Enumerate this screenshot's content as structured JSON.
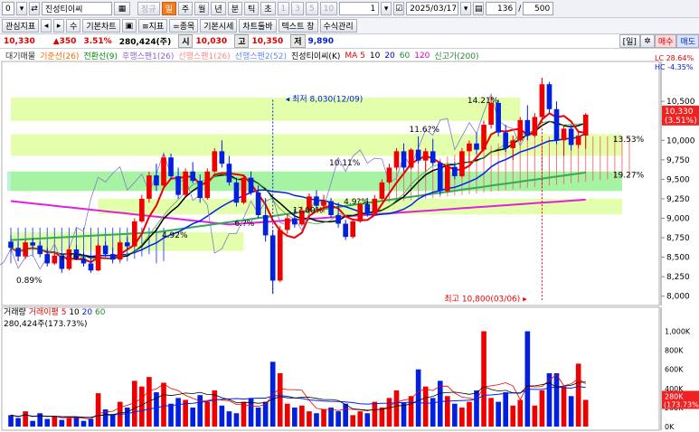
{
  "toolbar": {
    "code": "0",
    "stock_name": "진성티이씨",
    "periods": [
      "정규",
      "일",
      "주",
      "월",
      "년",
      "분",
      "틱",
      "초"
    ],
    "selected_period": "일",
    "minutes": [
      "1",
      "3",
      "5",
      "10"
    ],
    "count_value": "1",
    "date": "2025/03/17",
    "count": "136",
    "total": "500"
  },
  "toolbar2": {
    "items": [
      "관심지표",
      "◂",
      "▸",
      "수",
      "기본차트",
      "▣",
      "≡지표",
      "=종목",
      "기본시세",
      "차트툴바",
      "텍스트 창",
      "수식관리"
    ]
  },
  "quote": {
    "price": "10,330",
    "change": "▲350",
    "rate": "3.51%",
    "volume": "280,424(주)",
    "open_label": "시",
    "open": "10,030",
    "high_label": "고",
    "high": "10,350",
    "low_label": "저",
    "low": "9,890",
    "tab_day": "[일]",
    "tab_buy": "매수",
    "tab_sell": "매도"
  },
  "legend": {
    "items": [
      {
        "label": "대기매물",
        "color": "#333333"
      },
      {
        "label": "기준선(26)",
        "color": "#ff6600"
      },
      {
        "label": "전환선(9)",
        "color": "#008800"
      },
      {
        "label": "후행스팬1(26)",
        "color": "#8866cc"
      },
      {
        "label": "선행스팬1(26)",
        "color": "#ff8888"
      },
      {
        "label": "선행스팬2(52)",
        "color": "#6688ee"
      },
      {
        "label": "진성티이씨(K)",
        "color": "#000000"
      },
      {
        "label": "MA 5",
        "color": "#e00000"
      },
      {
        "label": "10",
        "color": "#000000"
      },
      {
        "label": "20",
        "color": "#0000cc"
      },
      {
        "label": "60",
        "color": "#228833"
      },
      {
        "label": "120",
        "color": "#cc00cc"
      },
      {
        "label": "신고가(200)",
        "color": "#228833"
      }
    ],
    "lc": "LC 28.64%",
    "hc": "HC -4.35%"
  },
  "annotations": {
    "low_marker": "최저 8,030(12/09)",
    "high_marker": "최고 10,800(03/06)",
    "pct": [
      "14.21%",
      "11.6?%",
      "10.11%",
      "1?.00%",
      "4.92%",
      "7.76%",
      "0.89%",
      "13.53%",
      "19.27%",
      "6.?%",
      "4.9?%"
    ]
  },
  "price_axis": {
    "ticks": [
      "10,500",
      "10,250",
      "10,000",
      "9,750",
      "9,500",
      "9,250",
      "9,000",
      "8,750",
      "8,500",
      "8,250",
      "8,000"
    ],
    "current": "10,330",
    "current_rate": "(3.51%)"
  },
  "volume": {
    "legend_title": "거래량",
    "legend_ma": "거래이평",
    "ma_periods": [
      "5",
      "10",
      "20",
      "60"
    ],
    "value_line": "280,424주(173.73%)",
    "ticks": [
      "1,000K",
      "800K",
      "600K",
      "400K",
      "200K",
      "0K"
    ],
    "current": "280K",
    "current_rate": "(173.73%)"
  },
  "chart_data": {
    "type": "candlestick",
    "ylim": [
      7950,
      10850
    ],
    "candles": [
      [
        8700,
        8780,
        8560,
        8620
      ],
      [
        8620,
        8700,
        8450,
        8510
      ],
      [
        8510,
        8720,
        8480,
        8690
      ],
      [
        8690,
        8740,
        8600,
        8650
      ],
      [
        8650,
        8700,
        8500,
        8540
      ],
      [
        8540,
        8620,
        8380,
        8420
      ],
      [
        8420,
        8560,
        8400,
        8520
      ],
      [
        8520,
        8540,
        8300,
        8350
      ],
      [
        8350,
        8640,
        8330,
        8600
      ],
      [
        8600,
        8660,
        8460,
        8480
      ],
      [
        8480,
        8560,
        8380,
        8420
      ],
      [
        8420,
        8500,
        8300,
        8330
      ],
      [
        8330,
        8680,
        8320,
        8650
      ],
      [
        8650,
        8700,
        8500,
        8540
      ],
      [
        8540,
        8620,
        8420,
        8470
      ],
      [
        8470,
        8720,
        8450,
        8690
      ],
      [
        8690,
        8760,
        8600,
        8640
      ],
      [
        8640,
        9000,
        8630,
        8960
      ],
      [
        8960,
        9300,
        8940,
        9250
      ],
      [
        9250,
        9600,
        9200,
        9550
      ],
      [
        9550,
        9700,
        9350,
        9420
      ],
      [
        9420,
        9820,
        9400,
        9780
      ],
      [
        9780,
        9830,
        9500,
        9540
      ],
      [
        9540,
        9650,
        9250,
        9300
      ],
      [
        9300,
        9640,
        9280,
        9600
      ],
      [
        9600,
        9720,
        9450,
        9480
      ],
      [
        9480,
        9560,
        9200,
        9260
      ],
      [
        9260,
        9640,
        9240,
        9600
      ],
      [
        9600,
        9900,
        9580,
        9860
      ],
      [
        9860,
        10000,
        9650,
        9700
      ],
      [
        9700,
        9800,
        9420,
        9460
      ],
      [
        9460,
        9520,
        9150,
        9200
      ],
      [
        9200,
        9560,
        9180,
        9520
      ],
      [
        9520,
        9600,
        9300,
        9330
      ],
      [
        9330,
        9420,
        9000,
        9040
      ],
      [
        9040,
        9260,
        8700,
        8780
      ],
      [
        8780,
        8850,
        8030,
        8200
      ],
      [
        8200,
        8900,
        8180,
        8850
      ],
      [
        8850,
        9050,
        8800,
        9000
      ],
      [
        9000,
        9120,
        8880,
        8920
      ],
      [
        8920,
        9150,
        8900,
        9100
      ],
      [
        9100,
        9320,
        9060,
        9280
      ],
      [
        9280,
        9360,
        9120,
        9160
      ],
      [
        9160,
        9300,
        9080,
        9220
      ],
      [
        9220,
        9260,
        9000,
        9040
      ],
      [
        9040,
        9200,
        8880,
        8930
      ],
      [
        8930,
        8980,
        8720,
        8760
      ],
      [
        8760,
        9000,
        8740,
        8960
      ],
      [
        8960,
        9200,
        8940,
        9180
      ],
      [
        9180,
        9260,
        9020,
        9060
      ],
      [
        9060,
        9300,
        9040,
        9250
      ],
      [
        9250,
        9500,
        9230,
        9460
      ],
      [
        9460,
        9700,
        9440,
        9650
      ],
      [
        9650,
        9900,
        9620,
        9860
      ],
      [
        9860,
        9960,
        9600,
        9650
      ],
      [
        9650,
        9900,
        9630,
        9880
      ],
      [
        9880,
        10050,
        9700,
        9740
      ],
      [
        9740,
        9900,
        9600,
        9860
      ],
      [
        9860,
        10020,
        9680,
        9710
      ],
      [
        9710,
        9740,
        9300,
        9350
      ],
      [
        9350,
        9700,
        9330,
        9660
      ],
      [
        9660,
        9720,
        9500,
        9540
      ],
      [
        9540,
        9900,
        9520,
        9860
      ],
      [
        9860,
        10000,
        9700,
        9960
      ],
      [
        9960,
        10100,
        9820,
        9880
      ],
      [
        9880,
        10250,
        9860,
        10200
      ],
      [
        10200,
        10560,
        10150,
        10480
      ],
      [
        10480,
        10520,
        10050,
        10100
      ],
      [
        10100,
        10200,
        9850,
        9900
      ],
      [
        9900,
        10060,
        9750,
        10000
      ],
      [
        10000,
        10300,
        9980,
        10260
      ],
      [
        10260,
        10450,
        10000,
        10060
      ],
      [
        10060,
        10350,
        10040,
        10300
      ],
      [
        10300,
        10800,
        10280,
        10720
      ],
      [
        10720,
        10750,
        10350,
        10400
      ],
      [
        10400,
        10500,
        9950,
        10000
      ],
      [
        10000,
        10200,
        9800,
        10150
      ],
      [
        10150,
        10200,
        9870,
        9940
      ],
      [
        9940,
        10120,
        9900,
        10060
      ],
      [
        10060,
        10350,
        9890,
        10330
      ]
    ],
    "volumes": [
      120,
      90,
      160,
      60,
      140,
      80,
      110,
      70,
      90,
      100,
      60,
      80,
      350,
      180,
      130,
      260,
      200,
      480,
      420,
      520,
      360,
      460,
      240,
      300,
      280,
      200,
      330,
      260,
      380,
      220,
      160,
      140,
      260,
      300,
      200,
      260,
      680,
      560,
      240,
      200,
      220,
      160,
      140,
      180,
      200,
      160,
      240,
      120,
      160,
      140,
      260,
      200,
      300,
      380,
      250,
      320,
      600,
      420,
      300,
      480,
      320,
      240,
      200,
      260,
      380,
      1000,
      300,
      260,
      360,
      220,
      280,
      1000,
      220,
      380,
      560,
      560,
      420,
      320,
      660,
      280
    ]
  }
}
